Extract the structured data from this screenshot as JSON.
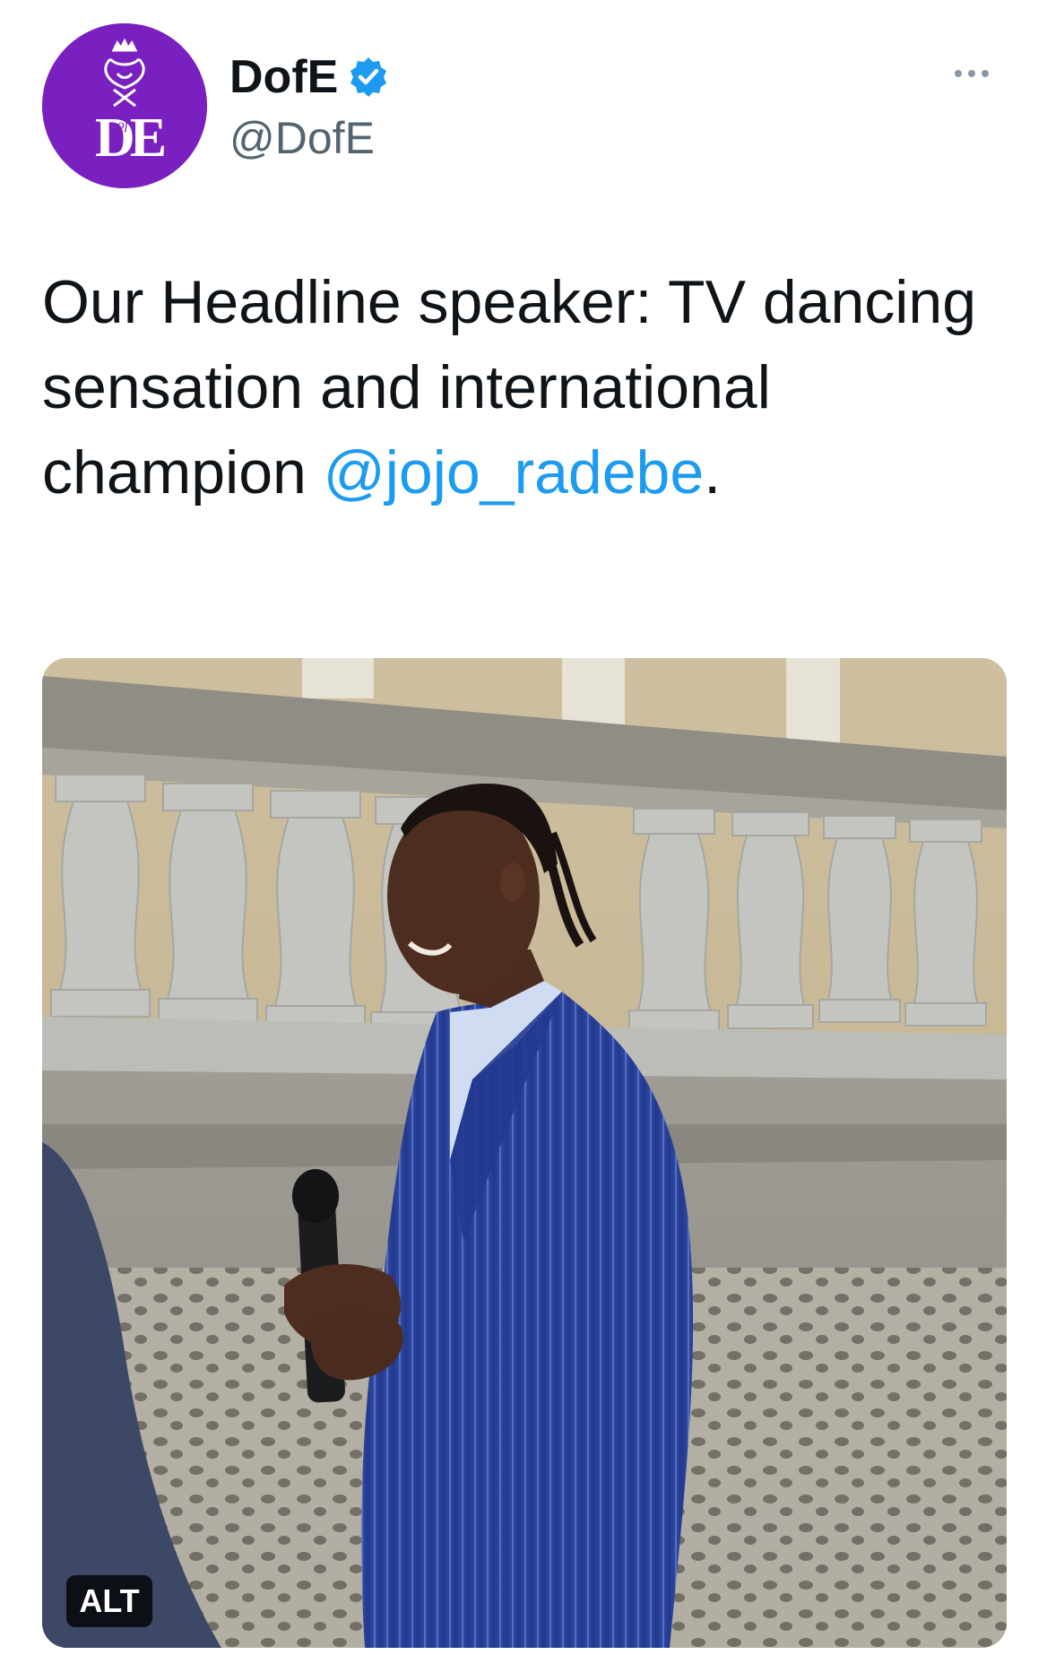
{
  "author": {
    "display_name": "DofE",
    "handle": "@DofE",
    "verified": true,
    "avatar_text": "DE",
    "avatar_small_text": "of",
    "avatar_color": "#7a1fc0"
  },
  "tweet": {
    "text_before_mention": "Our Headline speaker: TV dancing sensation and international champion ",
    "mention": "@jojo_radebe",
    "text_after_mention": "."
  },
  "media": {
    "alt_label": "ALT"
  },
  "colors": {
    "link": "#1d9bf0",
    "verified_badge": "#1d9bf0",
    "secondary_text": "#536471"
  },
  "icons": {
    "verified": "verified-badge-icon",
    "more": "more-options-icon"
  }
}
